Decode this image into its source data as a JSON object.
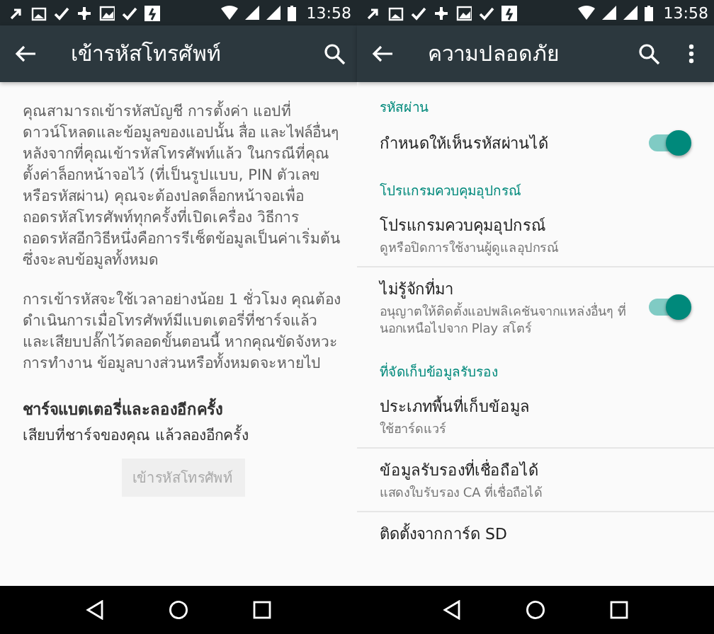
{
  "screens": [
    {
      "status_bar": {
        "time": "13:58"
      },
      "toolbar": {
        "title": "เข้ารหัสโทรศัพท์",
        "actions": [
          {
            "kind": "search"
          }
        ]
      },
      "kind": "encrypt",
      "paragraphs": [
        "คุณสามารถเข้ารหัสบัญชี การตั้งค่า แอปที่ดาวน์โหลดและข้อมูลของแอปนั้น สื่อ และไฟล์อื่นๆ หลังจากที่คุณเข้ารหัสโทรศัพท์แล้ว ในกรณีที่คุณตั้งค่าล็อกหน้าจอไว้ (ที่เป็นรูปแบบ, PIN ตัวเลข หรือรหัสผ่าน) คุณจะต้องปลดล็อกหน้าจอเพื่อถอดรหัสโทรศัพท์ทุกครั้งที่เปิดเครื่อง วิธีการถอดรหัสอีกวิธีหนึ่งคือการรีเซ็ตข้อมูลเป็นค่าเริ่มต้น ซึ่งจะลบข้อมูลทั้งหมด",
        "การเข้ารหัสจะใช้เวลาอย่างน้อย 1 ชั่วโมง คุณต้องดำเนินการเมื่อโทรศัพท์มีแบตเตอรี่ที่ชาร์จแล้วและเสียบปลั๊กไว้ตลอดขั้นตอนนี้ หากคุณขัดจังหวะการทำงาน ข้อมูลบางส่วนหรือทั้งหมดจะหายไป"
      ],
      "warning": {
        "title": "ชาร์จแบตเตอรี่และลองอีกครั้ง",
        "message": "เสียบที่ชาร์จของคุณ แล้วลองอีกครั้ง"
      },
      "button": {
        "label": "เข้ารหัสโทรศัพท์",
        "disabled": true
      }
    },
    {
      "status_bar": {
        "time": "13:58"
      },
      "toolbar": {
        "title": "ความปลอดภัย",
        "actions": [
          {
            "kind": "search"
          },
          {
            "kind": "more"
          }
        ]
      },
      "kind": "settings",
      "sections": [
        {
          "header": "รหัสผ่าน",
          "items": [
            {
              "title": "กำหนดให้เห็นรหัสผ่านได้",
              "on": true
            }
          ]
        },
        {
          "header": "โปรแกรมควบคุมอุปกรณ์",
          "items": [
            {
              "title": "โปรแกรมควบคุมอุปกรณ์",
              "summary": "ดูหรือปิดการใช้งานผู้ดูแลอุปกรณ์"
            },
            {
              "title": "ไม่รู้จักที่มา",
              "summary": "อนุญาตให้ติดตั้งแอปพลิเคชันจากแหล่งอื่นๆ ที่นอกเหนือไปจาก Play สโตร์",
              "on": true
            }
          ]
        },
        {
          "header": "ที่จัดเก็บข้อมูลรับรอง",
          "items": [
            {
              "title": "ประเภทพื้นที่เก็บข้อมูล",
              "summary": "ใช้ฮาร์ดแวร์"
            },
            {
              "title": "ข้อมูลรับรองที่เชื่อถือได้",
              "summary": "แสดงใบรับรอง CA ที่เชื่อถือได้"
            },
            {
              "title": "ติดตั้งจากการ์ด SD"
            }
          ]
        }
      ]
    }
  ]
}
